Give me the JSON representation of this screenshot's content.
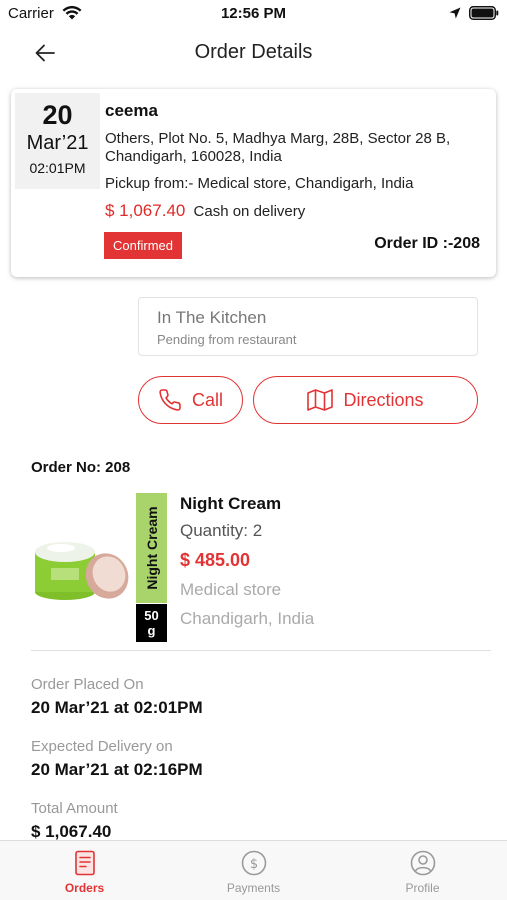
{
  "status_bar": {
    "carrier": "Carrier",
    "time": "12:56 PM"
  },
  "nav": {
    "title": "Order Details"
  },
  "order": {
    "day": "20",
    "month": "Mar’21",
    "time": "02:01PM",
    "customer": "ceema",
    "address": "Others, Plot No. 5, Madhya Marg, 28B, Sector 28 B, Chandigarh, 160028, India",
    "pickup": "Pickup from:- Medical store, Chandigarh, India",
    "amount": "$ 1,067.40",
    "payment_method": "Cash on delivery",
    "status": "Confirmed",
    "order_id": "Order ID :-208"
  },
  "kitchen": {
    "title": "In The Kitchen",
    "subtitle": "Pending from restaurant"
  },
  "actions": {
    "call": "Call",
    "directions": "Directions"
  },
  "order_no": "Order No: 208",
  "product": {
    "label": "Night Cream",
    "weight_top": "50",
    "weight_bottom": "g",
    "name": "Night Cream",
    "quantity": "Quantity: 2",
    "price": "$ 485.00",
    "store": "Medical store",
    "city": "Chandigarh, India"
  },
  "info": {
    "placed_label": "Order Placed On",
    "placed_value": "20 Mar’21 at 02:01PM",
    "expected_label": "Expected Delivery on",
    "expected_value": "20 Mar’21 at 02:16PM",
    "total_label": "Total Amount",
    "total_value": "$ 1,067.40"
  },
  "tabs": [
    {
      "label": "Orders",
      "icon": "orders-icon",
      "active": true
    },
    {
      "label": "Payments",
      "icon": "payments-icon",
      "active": false
    },
    {
      "label": "Profile",
      "icon": "profile-icon",
      "active": false
    }
  ],
  "colors": {
    "accent": "#e23434",
    "label_green": "#a9d36b"
  }
}
